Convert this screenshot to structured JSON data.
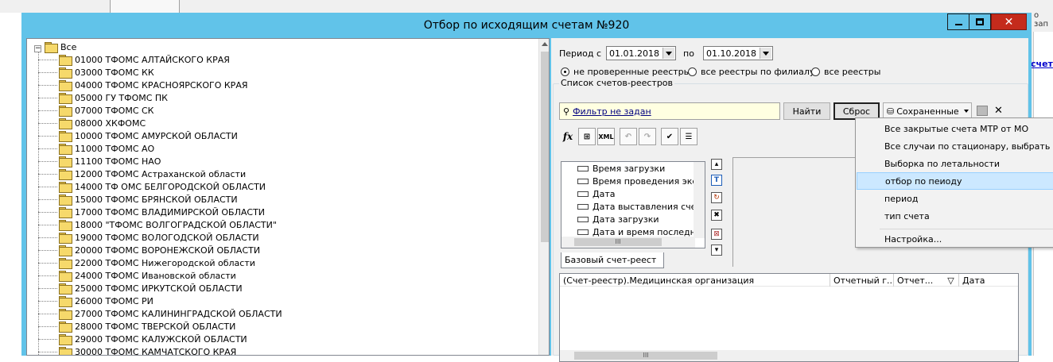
{
  "background": {
    "right_link": "счет",
    "right_text": "о зап"
  },
  "window": {
    "title": "Отбор по исходящим счетам №920",
    "close_glyph": "✕"
  },
  "tree": {
    "root_label": "Все",
    "expander": "−",
    "items": [
      "01000 ТФОМС АЛТАЙСКОГО КРАЯ",
      "03000 ТФОМС КК",
      "04000 ТФОМС КРАСНОЯРСКОГО КРАЯ",
      "05000 ГУ ТФОМС ПК",
      "07000 ТФОМС СК",
      "08000 ХКФОМС",
      "10000 ТФОМС АМУРСКОЙ ОБЛАСТИ",
      "11000 ТФОМС АО",
      "11100 ТФОМС НАО",
      "12000 ТФОМС Астраханской области",
      "14000 ТФ ОМС БЕЛГОРОДСКОЙ ОБЛАСТИ",
      "15000 ТФОМС БРЯНСКОЙ ОБЛАСТИ",
      "17000 ТФОМС ВЛАДИМИРСКОЙ ОБЛАСТИ",
      "18000 \"ТФОМС ВОЛГОГРАДСКОЙ ОБЛАСТИ\"",
      "19000 ТФОМС ВОЛОГОДСКОЙ ОБЛАСТИ",
      "20000 ТФОМС ВОРОНЕЖСКОЙ ОБЛАСТИ",
      "22000 ТФОМС Нижегородской области",
      "24000 ТФОМС Ивановской области",
      "25000 ТФОМС ИРКУТСКОЙ ОБЛАСТИ",
      "26000 ТФОМС РИ",
      "27000 ТФОМС КАЛИНИНГРАДСКОЙ ОБЛАСТИ",
      "28000 ТФОМС ТВЕРСКОЙ ОБЛАСТИ",
      "29000 ТФОМС КАЛУЖСКОЙ ОБЛАСТИ",
      "30000 ТФОМС КАМЧАТСКОГО КРАЯ"
    ]
  },
  "period": {
    "label_from": "Период с",
    "from_value": "01.01.2018",
    "label_to": "по",
    "to_value": "01.10.2018"
  },
  "radios": [
    {
      "label": "не проверенные реестры",
      "selected": true
    },
    {
      "label": "все реестры по филиалу",
      "selected": false
    },
    {
      "label": "все реестры",
      "selected": false
    }
  ],
  "list_group": {
    "title": "Список счетов-реестров",
    "filter_link": "Фильтр не задан",
    "find_button": "Найти",
    "reset_button": "Сброс",
    "saved_button": "Сохраненные",
    "close_glyph": "✕"
  },
  "toolbar": {
    "fx": "fx",
    "xml": "XML"
  },
  "fields": {
    "items": [
      "Время загрузки",
      "Время проведения экспе",
      "Дата",
      "Дата выставления счета",
      "Дата загрузки",
      "Дата и время последнег"
    ],
    "hscroll_glyph": "III",
    "tab_label": "Базовый счет-реест"
  },
  "sidebar_icons": [
    "T"
  ],
  "grid": {
    "columns": [
      "(Счет-реестр).Медицинская организация",
      "Отчетный г...",
      "Отчет...",
      "Дата"
    ],
    "hscroll_glyph": "III"
  },
  "menu": {
    "items": [
      "Все закрытые счета МТР от МО",
      "Все случаи по стационару, выбрать дату",
      "Выборка по летальности",
      "отбор по пеиоду",
      "период",
      "тип счета"
    ],
    "highlighted_index": 3,
    "settings": "Настройка..."
  }
}
